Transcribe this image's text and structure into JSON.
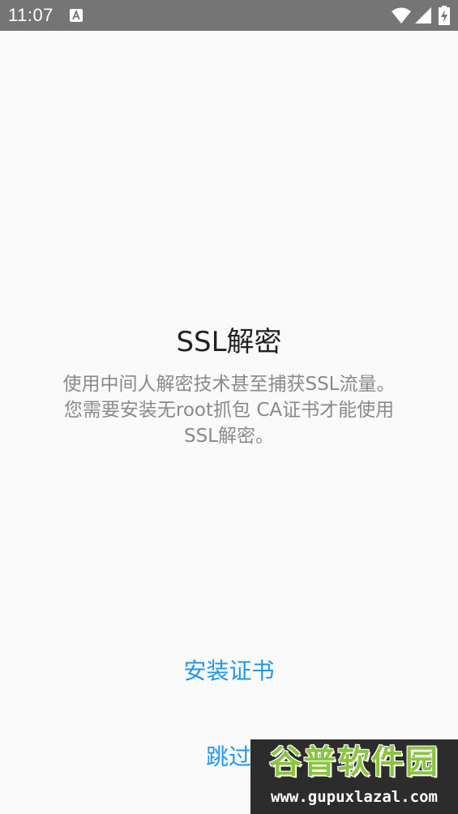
{
  "status_bar": {
    "time": "11:07",
    "notification_icon": "accessibility-a-icon",
    "wifi_icon": "wifi-icon",
    "signal_icon": "cell-signal-icon",
    "battery_icon": "battery-charging-icon",
    "background_color": "#757575"
  },
  "main": {
    "title": "SSL解密",
    "description_lines": [
      "使用中间人解密技术甚至捕获SSL流量。",
      "您需要安装无root抓包 CA证书才能使用",
      "SSL解密。"
    ],
    "install_button_label": "安装证书",
    "skip_button_label": "跳过"
  },
  "watermark": {
    "title": "谷普软件园",
    "url": "www.gupuxlazal.com"
  },
  "colors": {
    "accent": "#2196f3",
    "title_text": "#212121",
    "body_text": "#8a8a8a",
    "background": "#fafafa"
  }
}
